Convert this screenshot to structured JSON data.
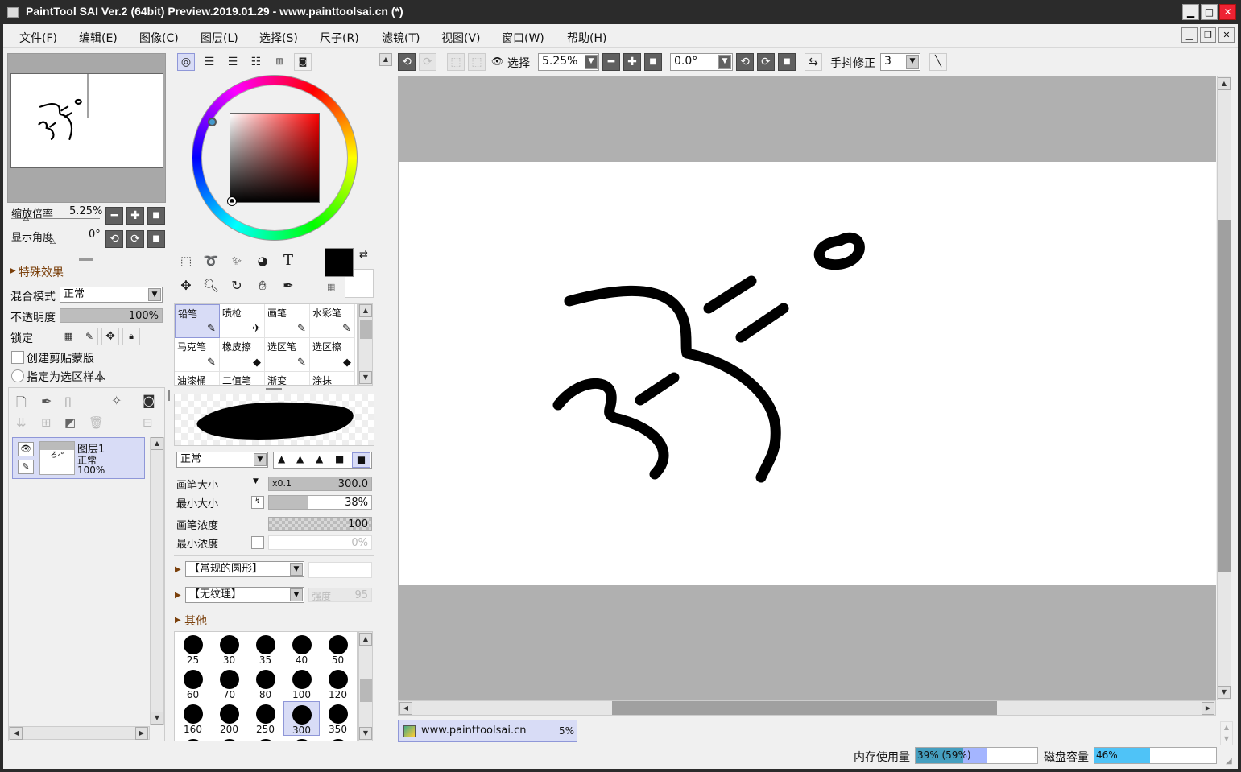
{
  "window": {
    "title": "PaintTool SAI Ver.2 (64bit) Preview.2019.01.29 - www.painttoolsai.cn (*)"
  },
  "menu": [
    "文件(F)",
    "编辑(E)",
    "图像(C)",
    "图层(L)",
    "选择(S)",
    "尺子(R)",
    "滤镜(T)",
    "视图(V)",
    "窗口(W)",
    "帮助(H)"
  ],
  "navigator": {
    "zoom_label": "缩放倍率",
    "zoom_value": "5.25%",
    "angle_label": "显示角度",
    "angle_value": "0°"
  },
  "layer_props": {
    "effects": "特殊效果",
    "blend_label": "混合模式",
    "blend_value": "正常",
    "opacity_label": "不透明度",
    "opacity_value": "100%",
    "lock_label": "锁定",
    "clip_label": "创建剪贴蒙版",
    "sample_label": "指定为选区样本"
  },
  "layer": {
    "name": "图层1",
    "mode": "正常",
    "opacity": "100%"
  },
  "colors": {
    "accent": "#d8dcf6",
    "memory_fill": "#2ecc71",
    "disk_fill": "#4fc3f7"
  },
  "tools_text_icon": "T",
  "brushes": [
    {
      "name": "铅笔",
      "icon": "✎"
    },
    {
      "name": "喷枪",
      "icon": "✈"
    },
    {
      "name": "画笔",
      "icon": "✎"
    },
    {
      "name": "水彩笔",
      "icon": "✎"
    },
    {
      "name": "马克笔",
      "icon": "✎"
    },
    {
      "name": "橡皮擦",
      "icon": "◆"
    },
    {
      "name": "选区笔",
      "icon": "✎"
    },
    {
      "name": "选区擦",
      "icon": "◆"
    },
    {
      "name": "油漆桶",
      "icon": ""
    },
    {
      "name": "二值笔",
      "icon": ""
    },
    {
      "name": "渐变",
      "icon": ""
    },
    {
      "name": "涂抹",
      "icon": ""
    }
  ],
  "brush_settings": {
    "blend_value": "正常",
    "size_label": "画笔大小",
    "size_mult": "x0.1",
    "size_value": "300.0",
    "min_size_label": "最小大小",
    "min_size_value": "38%",
    "min_size_fraction": 0.38,
    "density_label": "画笔浓度",
    "density_value": "100",
    "min_density_label": "最小浓度",
    "min_density_value": "0%",
    "shape_value": "【常规的圆形】",
    "texture_value": "【无纹理】",
    "texture_strength_label": "强度",
    "texture_strength_value": "95",
    "other_label": "其他"
  },
  "brush_sizes": [
    "25",
    "30",
    "35",
    "40",
    "50",
    "60",
    "70",
    "80",
    "100",
    "120",
    "160",
    "200",
    "250",
    "300",
    "350"
  ],
  "selected_size": "300",
  "toolbar": {
    "select_label": "选择",
    "zoom_value": "5.25%",
    "angle_value": "0.0°",
    "stabilizer_label": "手抖修正",
    "stabilizer_value": "3"
  },
  "doc_tab": {
    "name": "www.painttoolsai.cn",
    "zoom": "5%"
  },
  "status": {
    "memory_label": "内存使用量",
    "memory_value": "39% (59%)",
    "memory_fraction": 0.39,
    "disk_label": "磁盘容量",
    "disk_value": "46%",
    "disk_fraction": 0.46
  }
}
